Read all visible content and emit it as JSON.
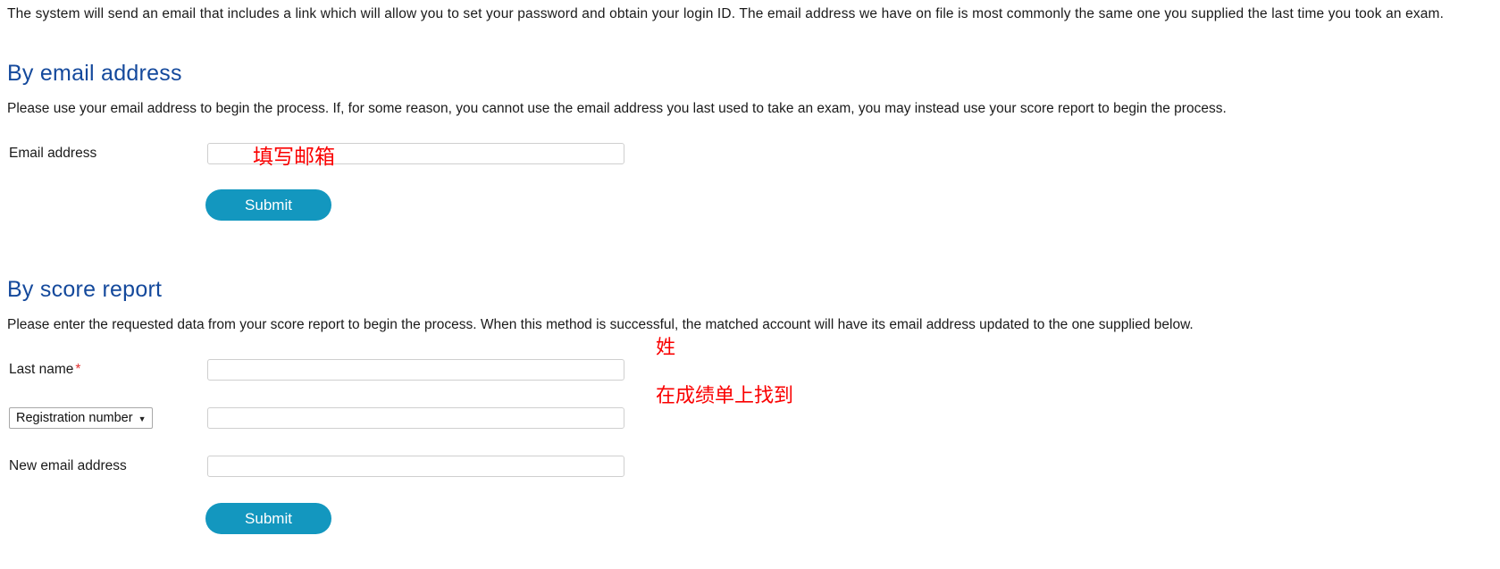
{
  "intro": {
    "paragraph": "The system will send an email that includes a link which will allow you to set your password and obtain your login ID. The email address we have on file is most commonly the same one you supplied the last time you took an exam."
  },
  "email_section": {
    "heading": "By email address",
    "paragraph": "Please use your email address to begin the process. If, for some reason, you cannot use the email address you last used to take an exam, you may instead use your score report to begin the process.",
    "email_label": "Email address",
    "email_value": "",
    "email_placeholder": "",
    "submit_label": "Submit"
  },
  "score_section": {
    "heading": "By score report",
    "paragraph": "Please enter the requested data from your score report to begin the process. When this method is successful, the matched account will have its email address updated to the one supplied below.",
    "last_name_label": "Last name",
    "last_name_required_mark": "*",
    "last_name_value": "",
    "id_type_selected": "Registration number",
    "id_type_caret": "▼",
    "id_value": "",
    "new_email_label": "New email address",
    "new_email_value": "",
    "submit_label": "Submit"
  },
  "annotations": {
    "email_note": "填写邮箱",
    "last_name_note": "姓",
    "reg_number_note": "在成绩单上找到"
  },
  "colors": {
    "heading_blue": "#14499c",
    "button_teal": "#1397bf",
    "annotation_red": "#fa0000",
    "required_red": "#e03030",
    "text": "#1a1a1a",
    "input_border": "#cfcfcf"
  }
}
